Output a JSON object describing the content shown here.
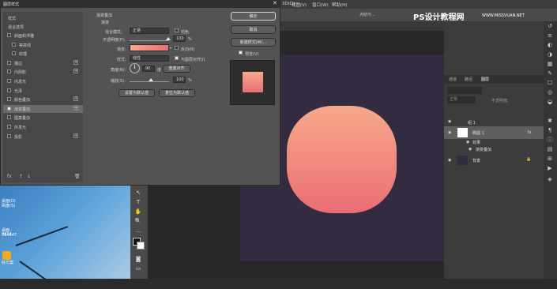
{
  "dialog": {
    "title": "图层样式",
    "close": "✕",
    "styles_header": "样式",
    "blend_options": "混合选项",
    "styles": [
      {
        "label": "斜面和浮雕",
        "checked": false,
        "plus": false
      },
      {
        "label": "等高线",
        "checked": false,
        "plus": false,
        "indent": true
      },
      {
        "label": "纹理",
        "checked": false,
        "plus": false,
        "indent": true
      },
      {
        "label": "描边",
        "checked": false,
        "plus": true
      },
      {
        "label": "内阴影",
        "checked": false,
        "plus": true
      },
      {
        "label": "内发光",
        "checked": false,
        "plus": false
      },
      {
        "label": "光泽",
        "checked": false,
        "plus": false
      },
      {
        "label": "颜色叠加",
        "checked": false,
        "plus": true
      },
      {
        "label": "渐变叠加",
        "checked": true,
        "plus": true,
        "selected": true
      },
      {
        "label": "图案叠加",
        "checked": false,
        "plus": false
      },
      {
        "label": "外发光",
        "checked": false,
        "plus": false
      },
      {
        "label": "投影",
        "checked": false,
        "plus": true
      }
    ],
    "footer": {
      "fx": "fx",
      "up": "↑",
      "down": "↓",
      "trash": "🗑"
    },
    "section_title": "渐变叠加",
    "group_title": "渐变",
    "blend_mode_label": "混合模式:",
    "blend_mode_value": "正常",
    "dither_label": "仿色",
    "opacity_label": "不透明度(P):",
    "opacity_value": "100",
    "opacity_unit": "%",
    "gradient_label": "渐变:",
    "reverse_label": "反向(R)",
    "style_label": "样式:",
    "style_value": "线性",
    "align_label": "与图层对齐(I)",
    "angle_label": "角度(N):",
    "angle_value": "90",
    "angle_unit": "度",
    "reset_align": "重置对齐",
    "scale_label": "缩放(S):",
    "scale_value": "100",
    "scale_unit": "%",
    "set_default": "设置为默认值",
    "reset_default": "复位为默认值",
    "ok": "确定",
    "cancel": "取消",
    "new_style": "新建样式(W)...",
    "preview_label": "预览(V)",
    "gradient_colors": [
      "#f7a98a",
      "#ea6e74"
    ]
  },
  "ps": {
    "menu": [
      "3D(D)",
      "视图(V)",
      "窗口(W)",
      "帮助(H)"
    ],
    "top_text": "点结与...",
    "watermark": "PS设计教程网",
    "watermark_url": "WWW.MISSVUAN.NET",
    "layers_tabs": [
      "通道",
      "路径",
      "图层"
    ],
    "kind_label": "正常",
    "opacity_label": "不透明度:",
    "layers": [
      {
        "name": "组 1",
        "type": "group"
      },
      {
        "name": "椭圆 1",
        "type": "shape",
        "fx": "fx"
      },
      {
        "name": "效果",
        "type": "effects"
      },
      {
        "name": "渐变叠加",
        "type": "effect"
      },
      {
        "name": "背景",
        "type": "background"
      }
    ]
  },
  "desktop": {
    "icons": [
      "桌面(D)",
      "网盘(S)",
      "桌面0014",
      "764647",
      "好方案"
    ]
  },
  "colors": {
    "canvas_bg": "#332c40",
    "shape_top": "#f7a98a",
    "shape_bottom": "#ea6e74"
  }
}
